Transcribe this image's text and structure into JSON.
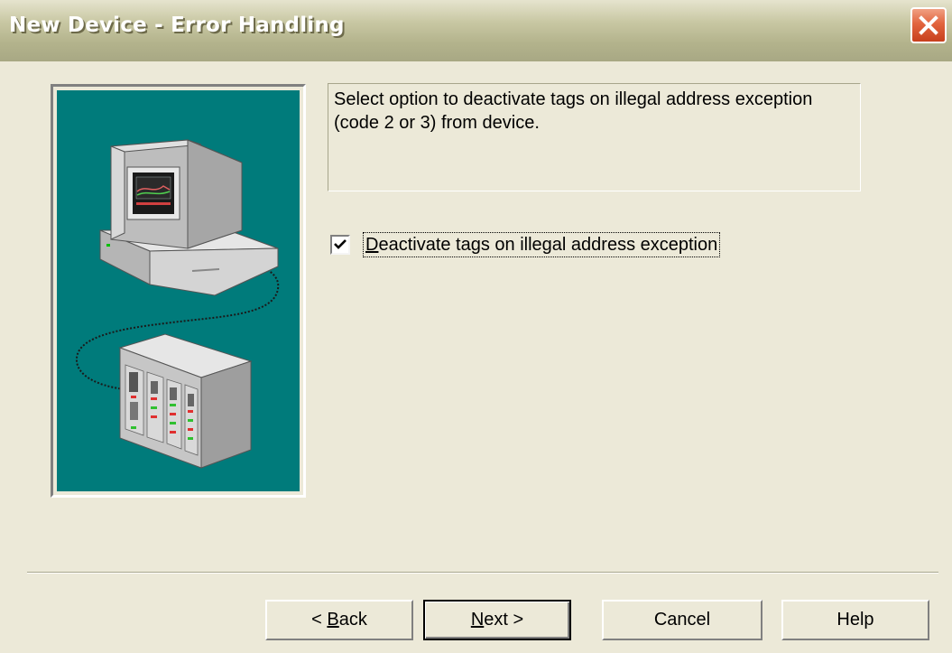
{
  "window": {
    "title": "New Device - Error Handling",
    "close_icon": "close-icon"
  },
  "illustration": {
    "background_color": "#007b7b",
    "depicts": [
      "computer-icon",
      "device-rack-icon",
      "cable"
    ]
  },
  "description": {
    "text": "Select option to deactivate tags on illegal address exception (code 2 or 3) from device."
  },
  "option": {
    "label_accel": "D",
    "label_rest": "eactivate tags on illegal address exception",
    "checked": true
  },
  "buttons": {
    "back": {
      "prefix": "< ",
      "accel": "B",
      "rest": "ack"
    },
    "next": {
      "accel": "N",
      "rest": "ext >"
    },
    "cancel": "Cancel",
    "help": "Help"
  }
}
